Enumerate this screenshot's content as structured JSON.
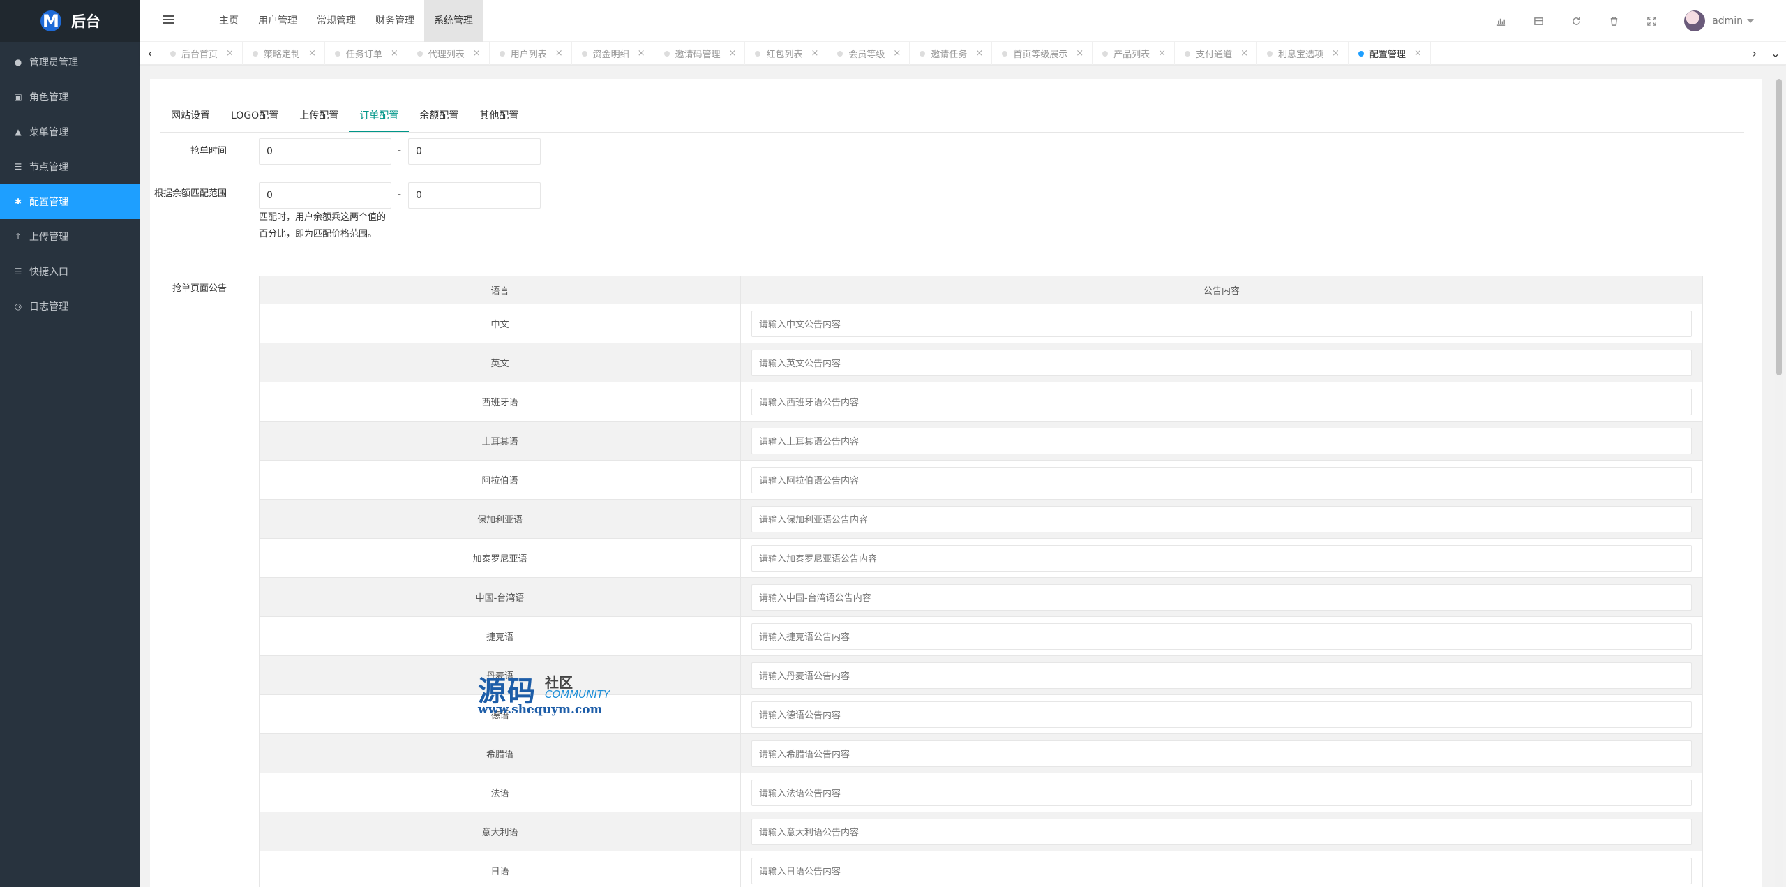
{
  "brand": {
    "logo_letter": "M",
    "title": "后台"
  },
  "sidebar": {
    "items": [
      {
        "label": "管理员管理",
        "icon": "user-icon"
      },
      {
        "label": "角色管理",
        "icon": "id-card-icon"
      },
      {
        "label": "菜单管理",
        "icon": "bell-icon"
      },
      {
        "label": "节点管理",
        "icon": "list-icon"
      },
      {
        "label": "配置管理",
        "icon": "gear-icon",
        "active": true
      },
      {
        "label": "上传管理",
        "icon": "upload-arrow-icon"
      },
      {
        "label": "快捷入口",
        "icon": "list-icon"
      },
      {
        "label": "日志管理",
        "icon": "circle-icon"
      }
    ]
  },
  "header": {
    "nav": [
      "主页",
      "用户管理",
      "常规管理",
      "财务管理",
      "系统管理"
    ],
    "active_nav": "系统管理",
    "user": "admin"
  },
  "tabs": [
    "后台首页",
    "策略定制",
    "任务订单",
    "代理列表",
    "用户列表",
    "资金明细",
    "邀请码管理",
    "红包列表",
    "会员等级",
    "邀请任务",
    "首页等级展示",
    "产品列表",
    "支付通道",
    "利息宝选项",
    "配置管理"
  ],
  "active_tab": "配置管理",
  "form_tabs": [
    "网站设置",
    "LOGO配置",
    "上传配置",
    "订单配置",
    "余额配置",
    "其他配置"
  ],
  "active_form_tab": "订单配置",
  "form": {
    "grab_time_label": "抢单时间",
    "grab_time_from": "0",
    "grab_time_to": "0",
    "balance_range_label": "根据余额匹配范围",
    "balance_range_from": "0",
    "balance_range_to": "0",
    "separator": "-",
    "balance_hint": "匹配时，用户余额乘这两个值的百分比，即为匹配价格范围。",
    "notice_label": "抢单页面公告"
  },
  "notice_table": {
    "headers": [
      "语言",
      "公告内容"
    ],
    "rows": [
      {
        "lang": "中文",
        "placeholder": "请输入中文公告内容"
      },
      {
        "lang": "英文",
        "placeholder": "请输入英文公告内容"
      },
      {
        "lang": "西班牙语",
        "placeholder": "请输入西班牙语公告内容"
      },
      {
        "lang": "土耳其语",
        "placeholder": "请输入土耳其语公告内容"
      },
      {
        "lang": "阿拉伯语",
        "placeholder": "请输入阿拉伯语公告内容"
      },
      {
        "lang": "保加利亚语",
        "placeholder": "请输入保加利亚语公告内容"
      },
      {
        "lang": "加泰罗尼亚语",
        "placeholder": "请输入加泰罗尼亚语公告内容"
      },
      {
        "lang": "中国-台湾语",
        "placeholder": "请输入中国-台湾语公告内容"
      },
      {
        "lang": "捷克语",
        "placeholder": "请输入捷克语公告内容"
      },
      {
        "lang": "丹麦语",
        "placeholder": "请输入丹麦语公告内容"
      },
      {
        "lang": "德语",
        "placeholder": "请输入德语公告内容"
      },
      {
        "lang": "希腊语",
        "placeholder": "请输入希腊语公告内容"
      },
      {
        "lang": "法语",
        "placeholder": "请输入法语公告内容"
      },
      {
        "lang": "意大利语",
        "placeholder": "请输入意大利语公告内容"
      },
      {
        "lang": "日语",
        "placeholder": "请输入日语公告内容"
      }
    ]
  },
  "watermark": {
    "title": "源码",
    "sub": "社区",
    "community": "COMMUNITY",
    "url": "www.shequym.com"
  },
  "colors": {
    "sidebar_bg": "#28333e",
    "active_blue": "#1e9fff",
    "tab_active_green": "#009688"
  }
}
